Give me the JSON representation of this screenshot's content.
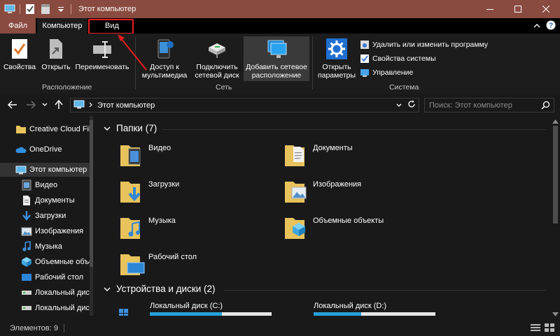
{
  "window": {
    "title": "Этот компьютер"
  },
  "tabs": {
    "file": "Файл",
    "computer": "Компьютер",
    "view": "Вид"
  },
  "ribbon": {
    "location": {
      "label": "Расположение",
      "properties": "Свойства",
      "open": "Открыть",
      "rename": "Переименовать"
    },
    "network": {
      "label": "Сеть",
      "media_line1": "Доступ к",
      "media_line2": "мультимедиа",
      "map_line1": "Подключить",
      "map_line2": "сетевой диск",
      "add_line1": "Добавить сетевое",
      "add_line2": "расположение"
    },
    "system": {
      "label": "Система",
      "settings_line1": "Открыть",
      "settings_line2": "параметры",
      "uninstall": "Удалить или изменить программу",
      "sysprops": "Свойства системы",
      "manage": "Управление"
    }
  },
  "address": {
    "crumb": "Этот компьютер",
    "search_placeholder": "Поиск: Этот компьютер"
  },
  "navpane": {
    "items": [
      {
        "label": "Creative Cloud Fil",
        "icon": "folder-icon"
      },
      {
        "label": "OneDrive",
        "icon": "cloud-icon"
      },
      {
        "label": "Этот компьютер",
        "icon": "computer-icon"
      },
      {
        "label": "Видео",
        "icon": "video-icon"
      },
      {
        "label": "Документы",
        "icon": "documents-icon"
      },
      {
        "label": "Загрузки",
        "icon": "download-icon"
      },
      {
        "label": "Изображения",
        "icon": "pictures-icon"
      },
      {
        "label": "Музыка",
        "icon": "music-icon"
      },
      {
        "label": "Объемные объе",
        "icon": "3d-icon"
      },
      {
        "label": "Рабочий стол",
        "icon": "desktop-icon"
      },
      {
        "label": "Локальный диск",
        "icon": "drive-icon"
      },
      {
        "label": "Локальный дис",
        "icon": "drive-icon"
      }
    ]
  },
  "folders": {
    "header": "Папки (7)",
    "items": [
      {
        "label": "Видео"
      },
      {
        "label": "Документы"
      },
      {
        "label": "Загрузки"
      },
      {
        "label": "Изображения"
      },
      {
        "label": "Музыка"
      },
      {
        "label": "Объемные объекты"
      },
      {
        "label": "Рабочий стол"
      }
    ]
  },
  "drives": {
    "header": "Устройства и диски (2)",
    "items": [
      {
        "label": "Локальный диск (C:)",
        "used_fraction": 0.59
      },
      {
        "label": "Локальный диск (D:)",
        "used_fraction": 0.39
      }
    ]
  },
  "status": {
    "items": "Элементов: 9"
  },
  "colors": {
    "titlebar": "#894a3f",
    "accent": "#26a0da",
    "highlight": "#e51e1e",
    "folder": "#e8c35c"
  }
}
